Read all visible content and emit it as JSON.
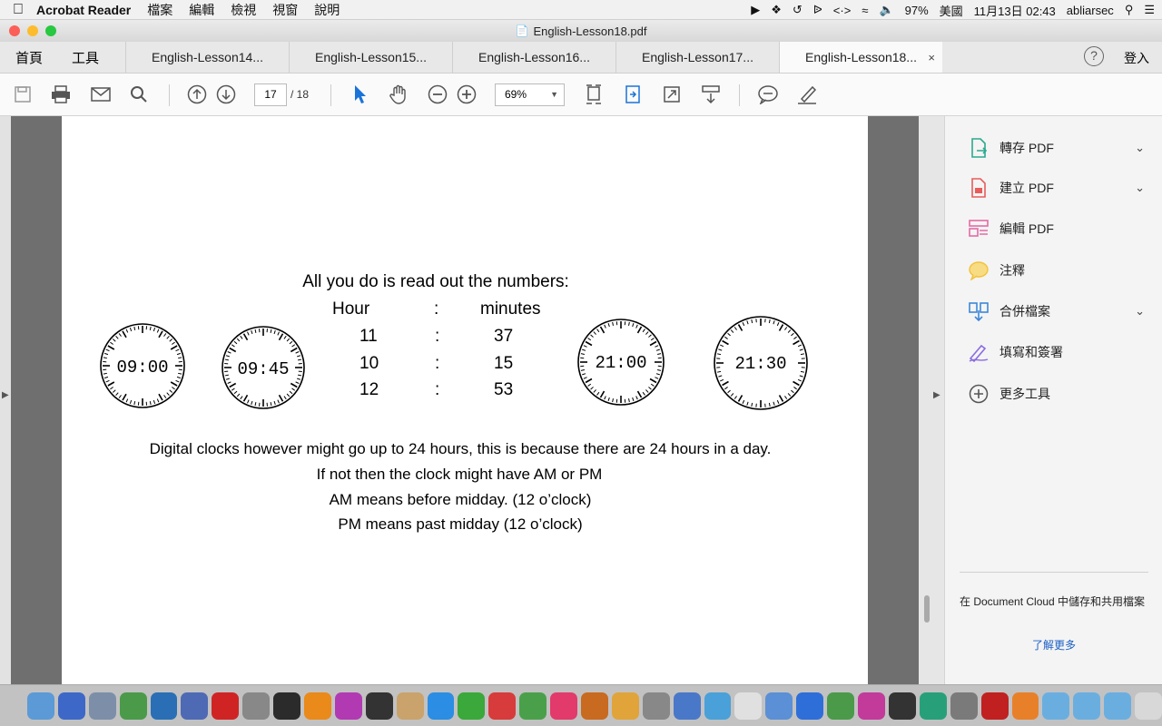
{
  "menubar": {
    "app_name": "Acrobat Reader",
    "menus": [
      "檔案",
      "編輯",
      "檢視",
      "視窗",
      "說明"
    ],
    "battery": "97%",
    "input_method": "美國",
    "datetime": "11月13日  02:43",
    "user": "abliarsec"
  },
  "window": {
    "title": "English-Lesson18.pdf"
  },
  "tabs": {
    "home": "首頁",
    "tools": "工具",
    "documents": [
      "English-Lesson14...",
      "English-Lesson15...",
      "English-Lesson16...",
      "English-Lesson17...",
      "English-Lesson18..."
    ],
    "close": "×",
    "login": "登入"
  },
  "toolbar": {
    "page_current": "17",
    "page_total": "/ 18",
    "zoom": "69%"
  },
  "document": {
    "intro": "All you do is read out the numbers:",
    "header_hour": "Hour",
    "header_sep": ":",
    "header_minutes": "minutes",
    "rows": [
      {
        "hour": "11",
        "sep": ":",
        "minutes": "37"
      },
      {
        "hour": "10",
        "sep": ":",
        "minutes": "15"
      },
      {
        "hour": "12",
        "sep": ":",
        "minutes": "53"
      }
    ],
    "clocks": [
      "09:00",
      "09:45",
      "21:00",
      "21:30"
    ],
    "line1": "Digital clocks however might go up to 24 hours, this is because there are 24 hours in a day.",
    "line2": "If not then the clock might have AM or PM",
    "line3": "AM means before midday. (12 o’clock)",
    "line4": "PM means past midday (12 o’clock)"
  },
  "sidepanel": {
    "items": [
      {
        "label": "轉存 PDF",
        "icon": "export-pdf-icon",
        "color": "#2aa98e"
      },
      {
        "label": "建立 PDF",
        "icon": "create-pdf-icon",
        "color": "#e85c5c"
      },
      {
        "label": "編輯 PDF",
        "icon": "edit-pdf-icon",
        "color": "#e56aa5"
      },
      {
        "label": "注釋",
        "icon": "comment-icon",
        "color": "#f2c23a"
      },
      {
        "label": "合併檔案",
        "icon": "combine-files-icon",
        "color": "#3c87d9"
      },
      {
        "label": "填寫和簽署",
        "icon": "fill-sign-icon",
        "color": "#8a6be0"
      },
      {
        "label": "更多工具",
        "icon": "more-tools-icon",
        "color": "#555555"
      }
    ],
    "cloud_text": "在 Document Cloud 中儲存和共用檔案",
    "learn_more": "了解更多"
  },
  "dock": {
    "colors": [
      "#5b9ad6",
      "#3d68c8",
      "#7d8fa8",
      "#4a9a4a",
      "#2a6fb5",
      "#4f6ab4",
      "#d02424",
      "#888888",
      "#2b2b2b",
      "#e98a1a",
      "#b13ab3",
      "#333333",
      "#c9a36b",
      "#2b8de4",
      "#3aa83a",
      "#d83b3b",
      "#4aa04a",
      "#e23a6a",
      "#c86a20",
      "#e0a43a",
      "#888888",
      "#4a78c8",
      "#4aa0d8",
      "#e0e0e0",
      "#5b8fd6",
      "#2e6ed9",
      "#4a9a4a",
      "#c23a9a",
      "#333333",
      "#27a07a",
      "#7a7a7a",
      "#c02020",
      "#e8802a",
      "#6aaee0",
      "#6aaee0",
      "#6aaee0",
      "#d8d8d8"
    ]
  }
}
